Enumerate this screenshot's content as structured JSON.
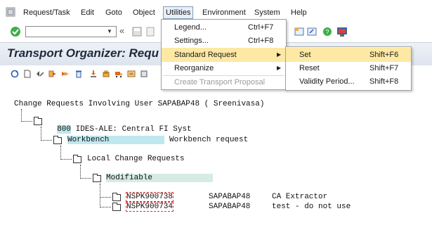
{
  "menubar": {
    "items": [
      "Request/Task",
      "Edit",
      "Goto",
      "Object",
      "Utilities",
      "Environment",
      "System",
      "Help"
    ]
  },
  "title": "Transport Organizer: Requ",
  "utilities_menu": {
    "items": [
      {
        "label": "Legend...",
        "shortcut": "Ctrl+F7"
      },
      {
        "label": "Settings...",
        "shortcut": "Ctrl+F8"
      },
      {
        "label": "Standard Request",
        "shortcut": ""
      },
      {
        "label": "Reorganize",
        "shortcut": ""
      },
      {
        "label": "Create Transport Proposal",
        "shortcut": ""
      }
    ]
  },
  "standard_request_menu": {
    "items": [
      {
        "label": "Set",
        "shortcut": "Shift+F6"
      },
      {
        "label": "Reset",
        "shortcut": "Shift+F7"
      },
      {
        "label": "Validity Period...",
        "shortcut": "Shift+F8"
      }
    ]
  },
  "tree": {
    "header": "Change Requests Involving User SAPABAP48 ( Sreenivasa)",
    "client_code": "800",
    "client_desc": "IDES-ALE: Central FI Syst",
    "workbench_label": "Workbench",
    "workbench_desc": "Workbench request",
    "local_label": "Local Change Requests",
    "modifiable_label": "Modifiable",
    "requests": [
      {
        "id": "NSPK900738",
        "owner": "SAPABAP48",
        "desc": "CA Extractor"
      },
      {
        "id": "NSPK900734",
        "owner": "SAPABAP48",
        "desc": "test - do not use"
      }
    ]
  },
  "colors": {
    "highlight": "#bfe7ee",
    "menu_hover": "#fde9a4",
    "title_bg": "#dde4ee"
  }
}
